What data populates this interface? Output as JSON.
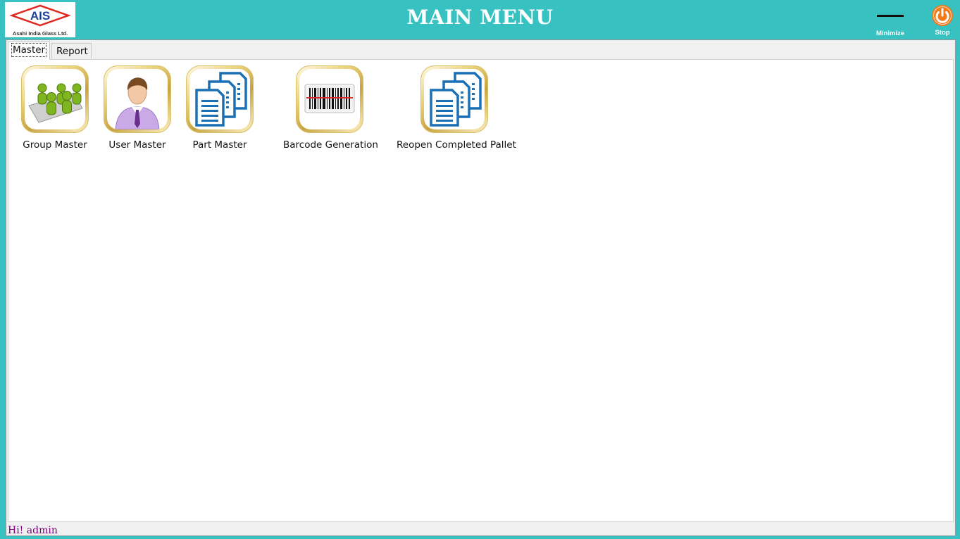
{
  "header": {
    "logo_text": "AIS",
    "logo_caption": "Asahi India Glass Ltd.",
    "title": "MAIN MENU",
    "minimize_label": "Minimize",
    "stop_label": "Stop",
    "colors": {
      "bar": "#37c1c1",
      "logo_red": "#e0281e",
      "logo_blue": "#1c3fa0",
      "stop_orange": "#f07a1a"
    }
  },
  "tabs": [
    {
      "label": "Master",
      "active": true
    },
    {
      "label": "Report",
      "active": false
    }
  ],
  "tiles": [
    {
      "label": "Group Master",
      "icon": "group-people-icon"
    },
    {
      "label": "User Master",
      "icon": "user-icon"
    },
    {
      "label": "Part Master",
      "icon": "documents-icon"
    },
    {
      "label": "Barcode Generation",
      "icon": "barcode-icon"
    },
    {
      "label": "Reopen Completed Pallet",
      "icon": "documents-icon"
    }
  ],
  "status": {
    "greeting": "Hi! admin"
  }
}
